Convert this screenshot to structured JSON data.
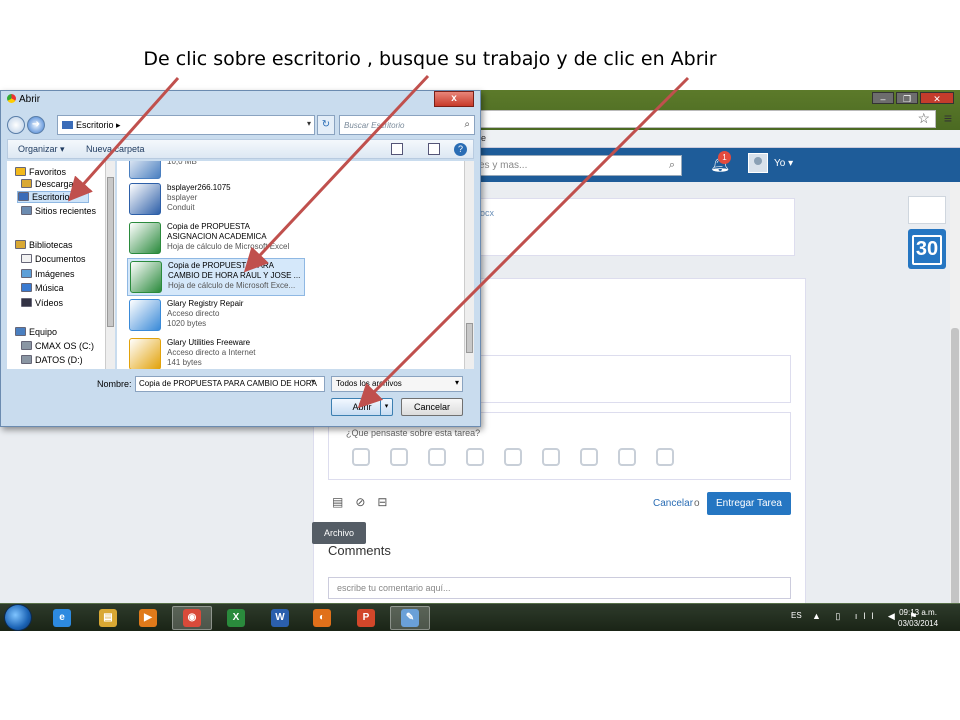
{
  "instruction": "De clic sobre escritorio , busque su trabajo y de clic en Abrir",
  "browser": {
    "bookmark_text": "re",
    "search_placeholder": "es y mas...",
    "notification_count": "1",
    "user_label": "Yo",
    "doc_link": "ocx",
    "reflection_prompt": "¿Que pensaste sobre esta tarea?",
    "tooltip": "Archivo",
    "cancel_label": "Cancelar",
    "or_label": "o",
    "submit_label": "Entregar Tarea",
    "comments_heading": "Comments",
    "comment_placeholder": "escribe tu comentario aquí...",
    "calendar_day": "30"
  },
  "dialog": {
    "title": "Abrir",
    "close_label": "x",
    "path": "Escritorio",
    "search_placeholder": "Buscar Escritorio",
    "toolbar": {
      "organize": "Organizar ▾",
      "new_folder": "Nueva carpeta"
    },
    "nav": [
      {
        "label": "Favoritos",
        "icon": "star-icon",
        "top": true
      },
      {
        "label": "Descargas",
        "icon": "downloads-icon"
      },
      {
        "label": "Escritorio",
        "icon": "desktop-icon",
        "selected": true
      },
      {
        "label": "Sitios recientes",
        "icon": "recent-icon"
      },
      {
        "label": "Bibliotecas",
        "icon": "library-icon",
        "top": true
      },
      {
        "label": "Documentos",
        "icon": "documents-icon"
      },
      {
        "label": "Imágenes",
        "icon": "pictures-icon"
      },
      {
        "label": "Música",
        "icon": "music-icon"
      },
      {
        "label": "Vídeos",
        "icon": "videos-icon"
      },
      {
        "label": "Equipo",
        "icon": "computer-icon",
        "top": true
      },
      {
        "label": "CMAX OS (C:)",
        "icon": "drive-icon"
      },
      {
        "label": "DATOS (D:)",
        "icon": "drive-icon"
      }
    ],
    "files": [
      {
        "name": "",
        "line2": "10,0 MB",
        "line3": "",
        "icon": "app-icon",
        "color": "#4a7fc0"
      },
      {
        "name": "bsplayer266.1075",
        "line2": "bsplayer",
        "line3": "Conduit",
        "icon": "bsplayer-icon",
        "color": "#2d5fa8"
      },
      {
        "name": "Copia de PROPUESTA\nASIGNACION ACADEMICA",
        "line2": "Hoja de cálculo de Microsoft Excel",
        "line3": "",
        "icon": "excel-icon",
        "color": "#2a8a3c"
      },
      {
        "name": "Copia de PROPUESTA PARA\nCAMBIO DE HORA RAUL Y JOSE ...",
        "line2": "Hoja de cálculo de Microsoft Exce...",
        "line3": "",
        "icon": "excel-icon",
        "color": "#2a8a3c",
        "selected": true
      },
      {
        "name": "Glary Registry Repair",
        "line2": "Acceso directo",
        "line3": "1020 bytes",
        "icon": "registry-icon",
        "color": "#3a8ad8"
      },
      {
        "name": "Glary Utilities Freeware",
        "line2": "Acceso directo a Internet",
        "line3": "141 bytes",
        "icon": "glary-icon",
        "color": "#e2a20a"
      }
    ],
    "filename_label": "Nombre:",
    "filename_value": "Copia de PROPUESTA PARA CAMBIO DE HORA",
    "filetype_value": "Todos los archivos",
    "open_label": "Abrir",
    "cancel_label": "Cancelar"
  },
  "taskbar": {
    "apps": [
      {
        "name": "ie-icon",
        "glyph": "e",
        "color": "#2d8ae0"
      },
      {
        "name": "explorer-icon",
        "glyph": "▤",
        "color": "#d9a833"
      },
      {
        "name": "media-player-icon",
        "glyph": "▶",
        "color": "#e07a1a"
      },
      {
        "name": "chrome-icon",
        "glyph": "◉",
        "color": "#d94a3a",
        "active": true
      },
      {
        "name": "excel-icon",
        "glyph": "X",
        "color": "#2a8a3c"
      },
      {
        "name": "word-icon",
        "glyph": "W",
        "color": "#2b5fad"
      },
      {
        "name": "firefox-icon",
        "glyph": "◐",
        "color": "#e0701a"
      },
      {
        "name": "powerpoint-icon",
        "glyph": "P",
        "color": "#d2472a"
      },
      {
        "name": "paint-icon",
        "glyph": "✎",
        "color": "#6aa0d8",
        "active": true
      }
    ],
    "lang": "ES",
    "time": "09:13 a.m.",
    "date": "03/03/2014"
  },
  "colors": {
    "accent": "#2576c2",
    "arrow": "#c0504d"
  }
}
